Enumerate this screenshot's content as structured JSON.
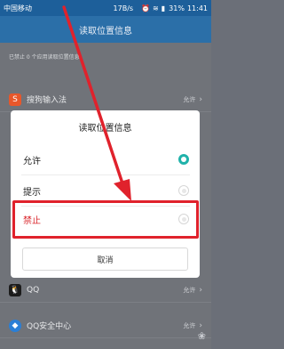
{
  "status_bar": {
    "carrier": "中国移动",
    "net_speed": "17B/s",
    "battery": "31%",
    "time": "11:41"
  },
  "header": {
    "title": "读取位置信息"
  },
  "info": "已禁止 0 个应用读取位置信息",
  "background_rows": [
    {
      "label": "搜狗输入法",
      "value": "允许",
      "icon": "sogou-icon",
      "color": "#e8572a"
    },
    {
      "label": "QQ",
      "value": "允许",
      "icon": "qq-icon",
      "color": "#1b1b1b"
    },
    {
      "label": "QQ安全中心",
      "value": "允许",
      "icon": "qq-security-icon",
      "color": "#2a7fd6"
    }
  ],
  "dialog": {
    "title": "读取位置信息",
    "options": [
      {
        "label": "允许",
        "selected": true
      },
      {
        "label": "提示",
        "selected": false
      },
      {
        "label": "禁止",
        "selected": false
      }
    ],
    "cancel_label": "取消"
  },
  "colors": {
    "accent": "#20b2aa",
    "highlight": "#e0222c",
    "app_bar": "#2b6fa8"
  }
}
